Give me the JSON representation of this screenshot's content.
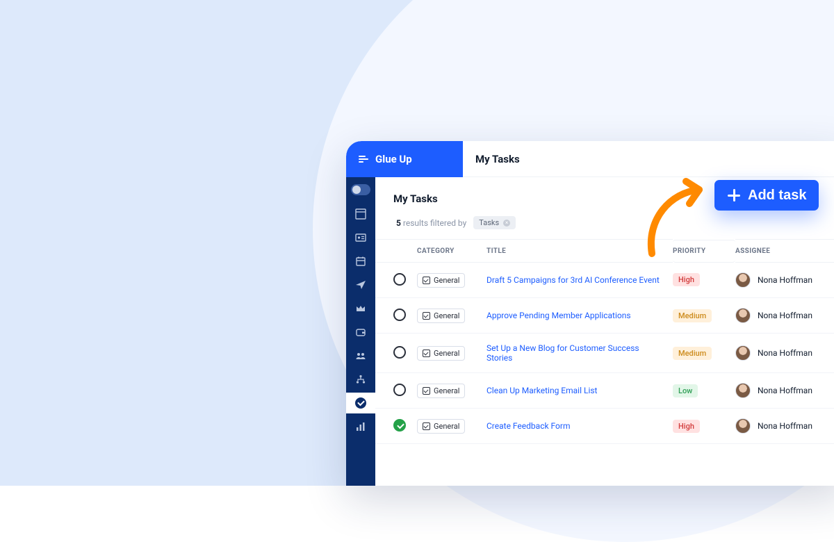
{
  "brand": "Glue Up",
  "header_title": "My Tasks",
  "section_title": "My Tasks",
  "filter": {
    "count": "5",
    "suffix": "results filtered by",
    "chip": "Tasks"
  },
  "columns": {
    "category": "CATEGORY",
    "title": "TITLE",
    "priority": "PRIORITY",
    "assignee": "ASSIGNEE"
  },
  "add_task_label": "Add task",
  "rows": [
    {
      "done": false,
      "category": "General",
      "title": "Draft 5 Campaigns for 3rd AI Conference Event",
      "priority": "High",
      "assignee": "Nona Hoffman"
    },
    {
      "done": false,
      "category": "General",
      "title": "Approve Pending Member Applications",
      "priority": "Medium",
      "assignee": "Nona Hoffman"
    },
    {
      "done": false,
      "category": "General",
      "title": "Set Up a New Blog for Customer Success Stories",
      "priority": "Medium",
      "assignee": "Nona Hoffman"
    },
    {
      "done": false,
      "category": "General",
      "title": "Clean Up Marketing Email List",
      "priority": "Low",
      "assignee": "Nona Hoffman"
    },
    {
      "done": true,
      "category": "General",
      "title": "Create Feedback Form",
      "priority": "High",
      "assignee": "Nona Hoffman"
    }
  ],
  "sidebar": {
    "items": [
      {
        "name": "dashboard-icon"
      },
      {
        "name": "id-card-icon"
      },
      {
        "name": "calendar-icon"
      },
      {
        "name": "send-icon"
      },
      {
        "name": "crown-icon"
      },
      {
        "name": "wallet-icon"
      },
      {
        "name": "people-icon"
      },
      {
        "name": "org-icon"
      },
      {
        "name": "tasks-icon",
        "active": true
      },
      {
        "name": "analytics-icon"
      }
    ]
  }
}
